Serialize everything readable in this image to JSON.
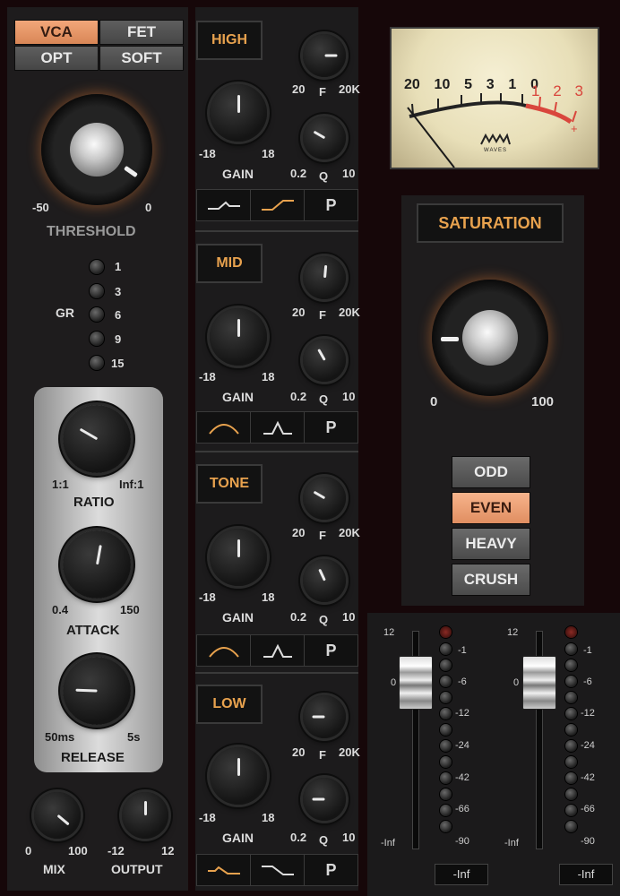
{
  "compressor": {
    "modes": [
      {
        "label": "VCA",
        "active": true
      },
      {
        "label": "FET",
        "active": false
      },
      {
        "label": "OPT",
        "active": false
      },
      {
        "label": "SOFT",
        "active": false
      }
    ],
    "threshold": {
      "label": "THRESHOLD",
      "min": "-50",
      "max": "0"
    },
    "gr": {
      "label": "GR",
      "marks": [
        "1",
        "3",
        "6",
        "9",
        "15"
      ]
    },
    "ratio": {
      "label": "RATIO",
      "min": "1:1",
      "max": "Inf:1"
    },
    "attack": {
      "label": "ATTACK",
      "min": "0.4",
      "max": "150"
    },
    "release": {
      "label": "RELEASE",
      "min": "50ms",
      "max": "5s"
    },
    "mix": {
      "label": "MIX",
      "min": "0",
      "max": "100"
    },
    "output": {
      "label": "OUTPUT",
      "min": "-12",
      "max": "12"
    }
  },
  "eq": {
    "bands": [
      {
        "name": "HIGH",
        "gain_label": "GAIN",
        "gain_min": "-18",
        "gain_max": "18",
        "freq_min": "20",
        "freq_label": "F",
        "freq_max": "20K",
        "q_min": "0.2",
        "q_label": "Q",
        "q_max": "10",
        "p_label": "P"
      },
      {
        "name": "MID",
        "gain_label": "GAIN",
        "gain_min": "-18",
        "gain_max": "18",
        "freq_min": "20",
        "freq_label": "F",
        "freq_max": "20K",
        "q_min": "0.2",
        "q_label": "Q",
        "q_max": "10",
        "p_label": "P"
      },
      {
        "name": "TONE",
        "gain_label": "GAIN",
        "gain_min": "-18",
        "gain_max": "18",
        "freq_min": "20",
        "freq_label": "F",
        "freq_max": "20K",
        "q_min": "0.2",
        "q_label": "Q",
        "q_max": "10",
        "p_label": "P"
      },
      {
        "name": "LOW",
        "gain_label": "GAIN",
        "gain_min": "-18",
        "gain_max": "18",
        "freq_min": "20",
        "freq_label": "F",
        "freq_max": "20K",
        "q_min": "0.2",
        "q_label": "Q",
        "q_max": "10",
        "p_label": "P"
      }
    ]
  },
  "vu": {
    "scale_black": [
      "20",
      "10",
      "5",
      "3",
      "1",
      "0"
    ],
    "scale_red": [
      "1",
      "2",
      "3"
    ],
    "plus": "+",
    "brand": "WAVES"
  },
  "saturation": {
    "title": "SATURATION",
    "min": "0",
    "max": "100",
    "types": [
      {
        "label": "ODD",
        "active": false
      },
      {
        "label": "EVEN",
        "active": true
      },
      {
        "label": "HEAVY",
        "active": false
      },
      {
        "label": "CRUSH",
        "active": false
      }
    ]
  },
  "meters": {
    "left_scale": [
      "12",
      "0",
      "-Inf"
    ],
    "right_scale": [
      "-1",
      "-6",
      "-12",
      "-24",
      "-42",
      "-66",
      "-90"
    ],
    "readouts": [
      "-Inf",
      "-Inf"
    ]
  },
  "colors": {
    "accent": "#e8a24e",
    "button_on": "#e99a6b",
    "vu_face": "#efe8c9",
    "vu_red": "#d9463c"
  }
}
